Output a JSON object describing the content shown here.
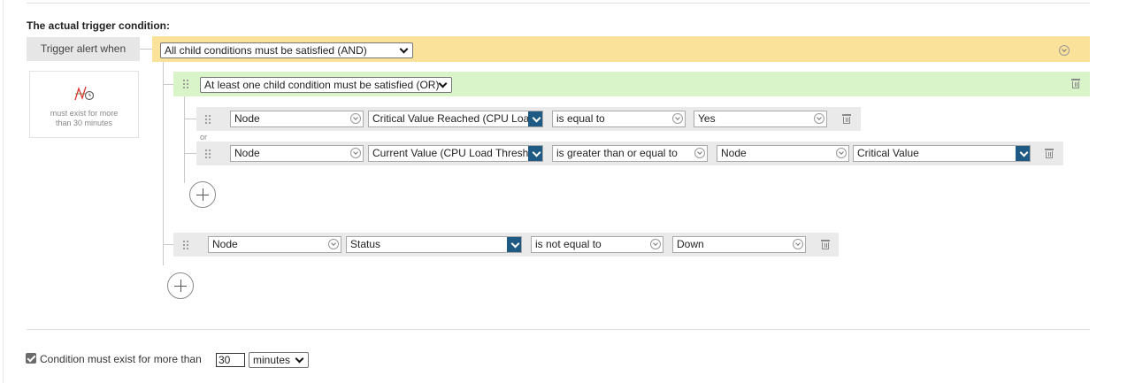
{
  "heading": "The actual trigger condition:",
  "trigger": {
    "label": "Trigger alert when",
    "and_select": "All child conditions must be satisfied (AND)"
  },
  "summary_card": {
    "icon": "threshold-time-icon",
    "text_line1": "must exist for more",
    "text_line2": "than 30 minutes"
  },
  "or_group": {
    "select": "At least one child condition must be satisfied (OR)",
    "separator": "or",
    "rows": [
      {
        "object": "Node",
        "field": "Critical Value Reached (CPU Loa",
        "operator": "is equal to",
        "value": "Yes"
      },
      {
        "object": "Node",
        "field": "Current Value (CPU Load Thresh",
        "operator": "is greater than or equal to",
        "value_object": "Node",
        "value": "Critical Value"
      }
    ]
  },
  "and_row": {
    "object": "Node",
    "field": "Status",
    "operator": "is not equal to",
    "value": "Down"
  },
  "footer": {
    "checkbox_checked": true,
    "condition_text": "Condition must exist for more than",
    "duration_value": "30",
    "unit_select": "minutes"
  },
  "colors": {
    "and_band": "#fbe29a",
    "or_band": "#daf4c9",
    "dropdown_button": "#1e5a83"
  }
}
